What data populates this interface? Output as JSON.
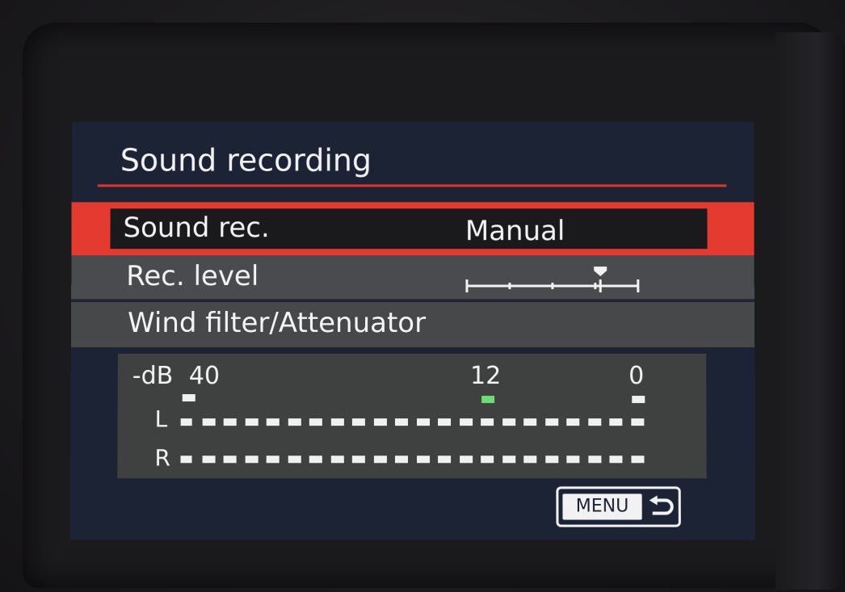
{
  "screen": {
    "title": "Sound recording",
    "items": [
      {
        "label": "Sound rec.",
        "value": "Manual",
        "selected": true
      },
      {
        "label": "Rec. level",
        "level_fraction": 0.78
      },
      {
        "label": "Wind filter/Attenuator"
      }
    ],
    "meter": {
      "scale_label": "-dB",
      "ticks": [
        "40",
        "12",
        "0"
      ],
      "channels": [
        "L",
        "R"
      ]
    },
    "menu_button": {
      "label": "MENU",
      "icon": "back-arrow-icon"
    }
  },
  "colors": {
    "accent": "#e53a2f",
    "screen_bg": "#1b2335",
    "meter_peak": "#6fdc72"
  }
}
